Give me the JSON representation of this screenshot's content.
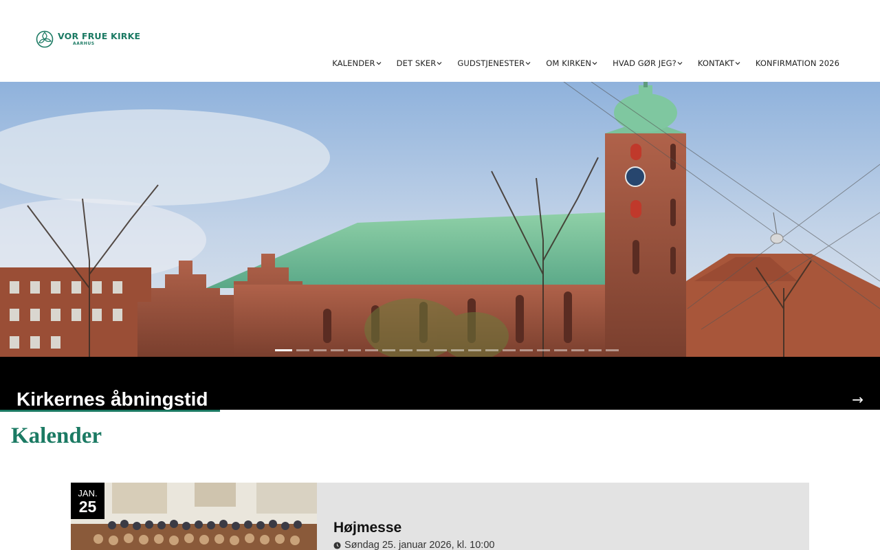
{
  "header": {
    "logo_name": "VOR FRUE KIRKE",
    "logo_city": "AARHUS",
    "brand_color": "#1b7a63"
  },
  "nav": {
    "items": [
      {
        "label": "KALENDER",
        "has_dropdown": true
      },
      {
        "label": "DET SKER",
        "has_dropdown": true
      },
      {
        "label": "GUDSTJENESTER",
        "has_dropdown": true
      },
      {
        "label": "OM KIRKEN",
        "has_dropdown": true
      },
      {
        "label": "HVAD GØR JEG?",
        "has_dropdown": true
      },
      {
        "label": "KONTAKT",
        "has_dropdown": true
      },
      {
        "label": "KONFIRMATION 2026",
        "has_dropdown": false
      }
    ]
  },
  "hero": {
    "slide_count": 20,
    "active_slide": 1
  },
  "banner": {
    "title": "Kirkernes åbningstid",
    "arrow_icon": "arrow-right-icon"
  },
  "calendar": {
    "title": "Kalender",
    "events": [
      {
        "month": "JAN.",
        "day": "25",
        "title": "Højmesse",
        "time": "Søndag 25. januar 2026, kl. 10:00"
      }
    ]
  }
}
